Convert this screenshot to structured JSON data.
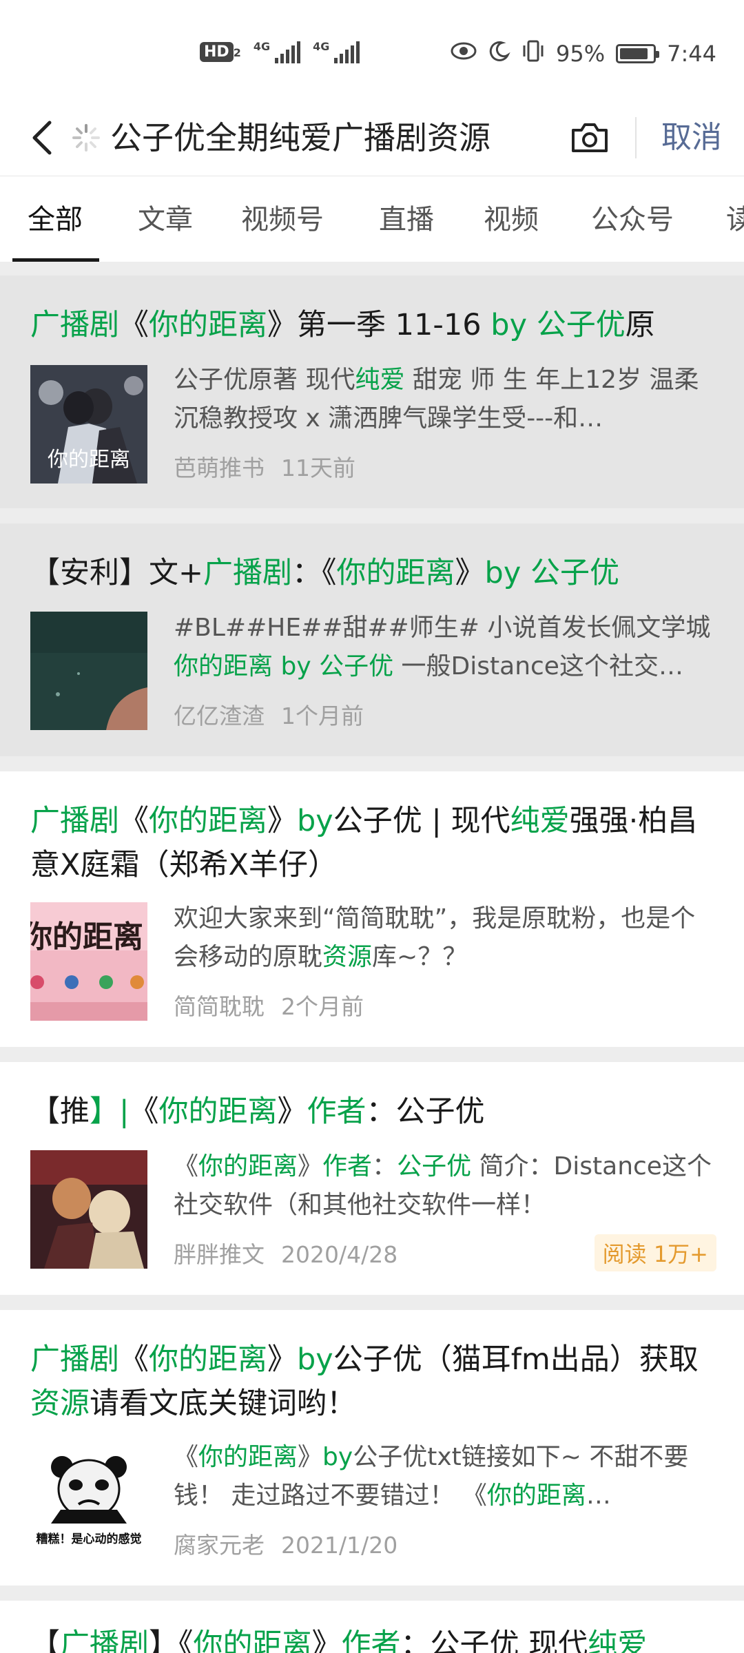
{
  "status": {
    "hd_badge": "HD",
    "hd_sub": "2",
    "signal_1_label": "4G",
    "signal_2_label": "4G",
    "battery_percent": "95%",
    "time": "7:44"
  },
  "search": {
    "query": "公子优全期纯爱广播剧资源",
    "cancel_label": "取消"
  },
  "tabs": [
    {
      "label": "全部",
      "active": true
    },
    {
      "label": "文章"
    },
    {
      "label": "视频号"
    },
    {
      "label": "直播"
    },
    {
      "label": "视频"
    },
    {
      "label": "公众号"
    },
    {
      "label": "读"
    }
  ],
  "results": [
    {
      "title_parts": [
        {
          "t": "广播剧",
          "hl": true
        },
        {
          "t": "《"
        },
        {
          "t": "你的距离",
          "hl": true
        },
        {
          "t": "》第一季 11-16 "
        },
        {
          "t": "by",
          "hl": true
        },
        {
          "t": " "
        },
        {
          "t": "公子优",
          "hl": true
        },
        {
          "t": "原"
        }
      ],
      "desc_parts": [
        {
          "t": "公子优原著 现代"
        },
        {
          "t": "纯爱",
          "hl": true
        },
        {
          "t": " 甜宠 师 生 年上12岁 温柔沉稳教授攻 x 潇洒脾气躁学生受---和…"
        }
      ],
      "thumb_caption": "你的距离",
      "meta_source": "芭萌推书",
      "meta_time": "11天前",
      "visited": true
    },
    {
      "title_parts": [
        {
          "t": "【安利】文+"
        },
        {
          "t": "广播剧",
          "hl": true
        },
        {
          "t": "：《"
        },
        {
          "t": "你的距离",
          "hl": true
        },
        {
          "t": "》"
        },
        {
          "t": "by",
          "hl": true
        },
        {
          "t": " "
        },
        {
          "t": "公子优",
          "hl": true
        }
      ],
      "desc_parts": [
        {
          "t": "#BL##HE##甜##师生# 小说首发长佩文学城 "
        },
        {
          "t": "你的距离",
          "hl": true
        },
        {
          "t": " "
        },
        {
          "t": "by",
          "hl": true
        },
        {
          "t": " "
        },
        {
          "t": "公子优",
          "hl": true
        },
        {
          "t": " 一般Distance这个社交…"
        }
      ],
      "meta_source": "亿亿渣渣",
      "meta_time": "1个月前",
      "visited": true
    },
    {
      "title_parts": [
        {
          "t": "广播剧",
          "hl": true
        },
        {
          "t": "《"
        },
        {
          "t": "你的距离",
          "hl": true
        },
        {
          "t": "》"
        },
        {
          "t": "by",
          "hl": true
        },
        {
          "t": "公子优 | 现代"
        },
        {
          "t": "纯爱",
          "hl": true
        },
        {
          "t": "强强·柏昌意X庭霜（郑希X羊仔）"
        }
      ],
      "desc_parts": [
        {
          "t": "欢迎大家来到“简简耽耽”，我是原耽粉，也是个会移动的原耽"
        },
        {
          "t": "资源",
          "hl": true
        },
        {
          "t": "库~？？"
        }
      ],
      "thumb_caption": "你的距离",
      "meta_source": "简简耽耽",
      "meta_time": "2个月前",
      "visited": false
    },
    {
      "title_parts": [
        {
          "t": "【推"
        },
        {
          "t": "】|",
          "hl": true
        },
        {
          "t": "《"
        },
        {
          "t": "你的距离",
          "hl": true
        },
        {
          "t": "》"
        },
        {
          "t": "作者",
          "hl": true
        },
        {
          "t": "：公子优"
        }
      ],
      "desc_parts": [
        {
          "t": "《"
        },
        {
          "t": "你的距离",
          "hl": true
        },
        {
          "t": "》"
        },
        {
          "t": "作者",
          "hl": true
        },
        {
          "t": "："
        },
        {
          "t": "公子优",
          "hl": true
        },
        {
          "t": " 简介：Distance这个社交软件（和其他社交软件一样！"
        }
      ],
      "meta_source": "胖胖推文",
      "meta_time": "2020/4/28",
      "read_badge": "阅读 1万+",
      "visited": false
    },
    {
      "title_parts": [
        {
          "t": "广播剧",
          "hl": true
        },
        {
          "t": "《"
        },
        {
          "t": "你的距离",
          "hl": true
        },
        {
          "t": "》"
        },
        {
          "t": "by",
          "hl": true
        },
        {
          "t": "公子优（猫耳fm出品）获取"
        },
        {
          "t": "资源",
          "hl": true
        },
        {
          "t": "请看文底关键词哟！"
        }
      ],
      "desc_parts": [
        {
          "t": "《"
        },
        {
          "t": "你的距离",
          "hl": true
        },
        {
          "t": "》"
        },
        {
          "t": "by",
          "hl": true
        },
        {
          "t": "公子优txt链接如下~ 不甜不要钱！ 走过路过不要错过！ 《"
        },
        {
          "t": "你的距离",
          "hl": true
        },
        {
          "t": "…"
        }
      ],
      "thumb_caption": "糟糕！是心动的感觉",
      "meta_source": "腐家元老",
      "meta_time": "2021/1/20",
      "visited": false
    },
    {
      "title_parts": [
        {
          "t": "【"
        },
        {
          "t": "广播剧",
          "hl": true
        },
        {
          "t": "】《"
        },
        {
          "t": "你的距离",
          "hl": true
        },
        {
          "t": "》"
        },
        {
          "t": "作者",
          "hl": true
        },
        {
          "t": "：公子优 现代"
        },
        {
          "t": "纯爱",
          "hl": true
        }
      ],
      "visited": false
    }
  ]
}
